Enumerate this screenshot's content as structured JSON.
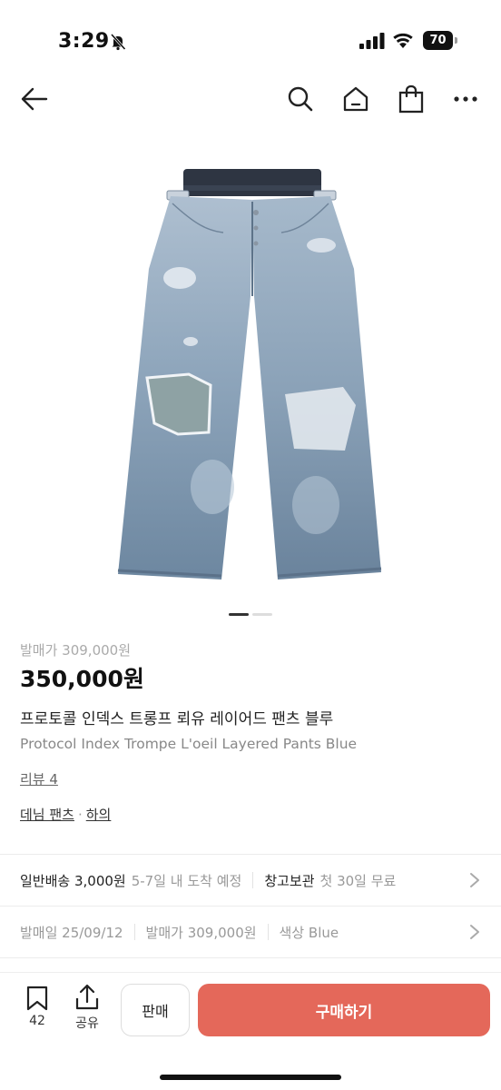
{
  "status_bar": {
    "time": "3:29",
    "battery_level": "70"
  },
  "nav": {
    "back_icon": "arrow-left-icon",
    "search_icon": "search-icon",
    "home_icon": "home-icon",
    "bag_icon": "shopping-bag-icon",
    "more_icon": "more-horizontal-icon"
  },
  "product": {
    "image_count": 2,
    "active_image": 1,
    "release_price": "발매가 309,000원",
    "price": "350,000원",
    "title_ko": "프로토콜 인덱스 트롱프 뢰유 레이어드 팬츠 블루",
    "title_en": "Protocol Index Trompe L'oeil Layered Pants Blue",
    "review_link": "리뷰 4",
    "category_1": "데님 팬츠",
    "category_sep": "·",
    "category_2": "하의"
  },
  "shipping_row": {
    "label": "일반배송 3,000원",
    "eta": "5-7일 내 도착 예정",
    "warehouse_label": "창고보관",
    "warehouse_note": "첫 30일 무료"
  },
  "detail_row": {
    "release_date": "발매일 25/09/12",
    "release_price": "발매가 309,000원",
    "color": "색상 Blue"
  },
  "bottom_bar": {
    "bookmark_count": "42",
    "share_label": "공유",
    "sell_label": "판매",
    "buy_label": "구매하기"
  },
  "colors": {
    "buy_button": "#e4685a",
    "denim_light": "#a8bccf",
    "denim_dark": "#5f7892",
    "waistband": "#2e3542"
  }
}
